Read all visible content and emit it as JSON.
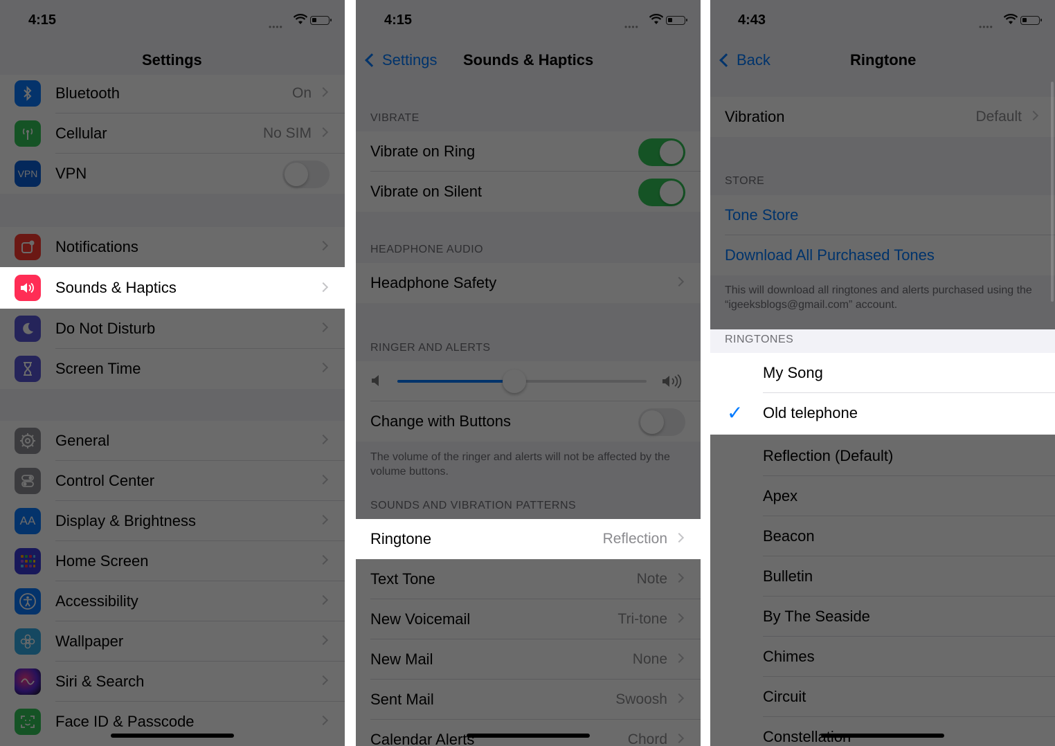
{
  "panel1": {
    "time": "4:15",
    "title": "Settings",
    "rows": {
      "bluetooth": {
        "label": "Bluetooth",
        "value": "On"
      },
      "cellular": {
        "label": "Cellular",
        "value": "No SIM"
      },
      "vpn": {
        "label": "VPN",
        "icon_text": "VPN"
      },
      "notifications": {
        "label": "Notifications"
      },
      "sounds": {
        "label": "Sounds & Haptics"
      },
      "dnd": {
        "label": "Do Not Disturb"
      },
      "screen_time": {
        "label": "Screen Time"
      },
      "general": {
        "label": "General"
      },
      "control_center": {
        "label": "Control Center"
      },
      "display": {
        "label": "Display & Brightness",
        "icon_text": "AA"
      },
      "home_screen": {
        "label": "Home Screen"
      },
      "accessibility": {
        "label": "Accessibility"
      },
      "wallpaper": {
        "label": "Wallpaper"
      },
      "siri": {
        "label": "Siri & Search"
      },
      "faceid": {
        "label": "Face ID & Passcode"
      }
    }
  },
  "panel2": {
    "time": "4:15",
    "back_label": "Settings",
    "title": "Sounds & Haptics",
    "headers": {
      "vibrate": "VIBRATE",
      "headphone": "HEADPHONE AUDIO",
      "ringer": "RINGER AND ALERTS",
      "patterns": "SOUNDS AND VIBRATION PATTERNS"
    },
    "rows": {
      "vibrate_ring": {
        "label": "Vibrate on Ring",
        "on": true
      },
      "vibrate_silent": {
        "label": "Vibrate on Silent",
        "on": true
      },
      "headphone_safety": {
        "label": "Headphone Safety"
      },
      "change_buttons": {
        "label": "Change with Buttons",
        "on": false
      },
      "ringtone": {
        "label": "Ringtone",
        "value": "Reflection"
      },
      "text_tone": {
        "label": "Text Tone",
        "value": "Note"
      },
      "voicemail": {
        "label": "New Voicemail",
        "value": "Tri-tone"
      },
      "new_mail": {
        "label": "New Mail",
        "value": "None"
      },
      "sent_mail": {
        "label": "Sent Mail",
        "value": "Swoosh"
      },
      "calendar": {
        "label": "Calendar Alerts",
        "value": "Chord"
      }
    },
    "ringer_volume": 0.47,
    "ringer_footer": "The volume of the ringer and alerts will not be affected by the volume buttons."
  },
  "panel3": {
    "time": "4:43",
    "back_label": "Back",
    "title": "Ringtone",
    "vibration": {
      "label": "Vibration",
      "value": "Default"
    },
    "store_header": "STORE",
    "tone_store": "Tone Store",
    "download_all": "Download All Purchased Tones",
    "store_footer": "This will download all ringtones and alerts purchased using the “igeeksblogs@gmail.com” account.",
    "ringtones_header": "RINGTONES",
    "ringtones": [
      "My Song",
      "Old telephone",
      "Reflection (Default)",
      "Apex",
      "Beacon",
      "Bulletin",
      "By The Seaside",
      "Chimes",
      "Circuit",
      "Constellation"
    ],
    "selected": "Old telephone"
  },
  "colors": {
    "accent": "#007aff",
    "toggle_on": "#34c759",
    "dim_overlay": "rgba(0,0,0,0.58)"
  }
}
